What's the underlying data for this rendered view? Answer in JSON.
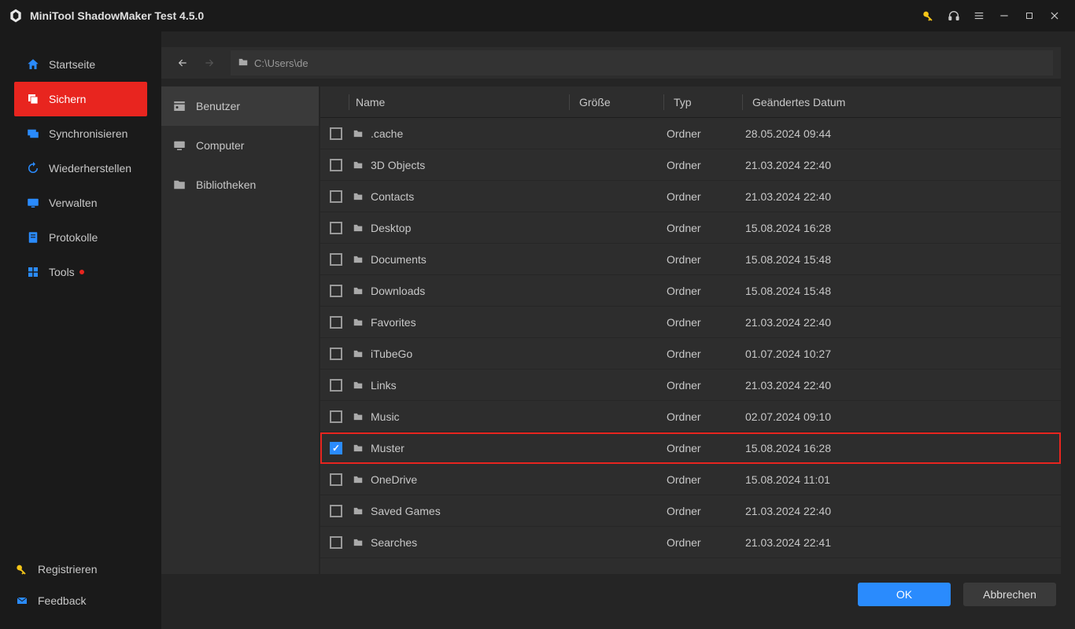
{
  "app": {
    "title": "MiniTool ShadowMaker Test 4.5.0"
  },
  "sidebar": {
    "items": [
      {
        "label": "Startseite",
        "icon": "home"
      },
      {
        "label": "Sichern",
        "icon": "backup"
      },
      {
        "label": "Synchronisieren",
        "icon": "sync"
      },
      {
        "label": "Wiederherstellen",
        "icon": "restore"
      },
      {
        "label": "Verwalten",
        "icon": "manage"
      },
      {
        "label": "Protokolle",
        "icon": "logs"
      },
      {
        "label": "Tools",
        "icon": "tools"
      }
    ],
    "active_index": 1,
    "bottom": [
      {
        "label": "Registrieren",
        "icon": "key"
      },
      {
        "label": "Feedback",
        "icon": "mail"
      }
    ]
  },
  "path": "C:\\Users\\de",
  "folders_pane": {
    "items": [
      {
        "label": "Benutzer"
      },
      {
        "label": "Computer"
      },
      {
        "label": "Bibliotheken"
      }
    ],
    "active_index": 0
  },
  "columns": {
    "name": "Name",
    "size": "Größe",
    "type": "Typ",
    "date": "Geändertes Datum"
  },
  "rows": [
    {
      "name": ".cache",
      "type": "Ordner",
      "date": "28.05.2024 09:44",
      "checked": false
    },
    {
      "name": "3D Objects",
      "type": "Ordner",
      "date": "21.03.2024 22:40",
      "checked": false
    },
    {
      "name": "Contacts",
      "type": "Ordner",
      "date": "21.03.2024 22:40",
      "checked": false
    },
    {
      "name": "Desktop",
      "type": "Ordner",
      "date": "15.08.2024 16:28",
      "checked": false
    },
    {
      "name": "Documents",
      "type": "Ordner",
      "date": "15.08.2024 15:48",
      "checked": false
    },
    {
      "name": "Downloads",
      "type": "Ordner",
      "date": "15.08.2024 15:48",
      "checked": false
    },
    {
      "name": "Favorites",
      "type": "Ordner",
      "date": "21.03.2024 22:40",
      "checked": false
    },
    {
      "name": "iTubeGo",
      "type": "Ordner",
      "date": "01.07.2024 10:27",
      "checked": false
    },
    {
      "name": "Links",
      "type": "Ordner",
      "date": "21.03.2024 22:40",
      "checked": false
    },
    {
      "name": "Music",
      "type": "Ordner",
      "date": "02.07.2024 09:10",
      "checked": false
    },
    {
      "name": "Muster",
      "type": "Ordner",
      "date": "15.08.2024 16:28",
      "checked": true,
      "highlight": true
    },
    {
      "name": "OneDrive",
      "type": "Ordner",
      "date": "15.08.2024 11:01",
      "checked": false
    },
    {
      "name": "Saved Games",
      "type": "Ordner",
      "date": "21.03.2024 22:40",
      "checked": false
    },
    {
      "name": "Searches",
      "type": "Ordner",
      "date": "21.03.2024 22:41",
      "checked": false
    }
  ],
  "footer": {
    "ok": "OK",
    "cancel": "Abbrechen"
  }
}
